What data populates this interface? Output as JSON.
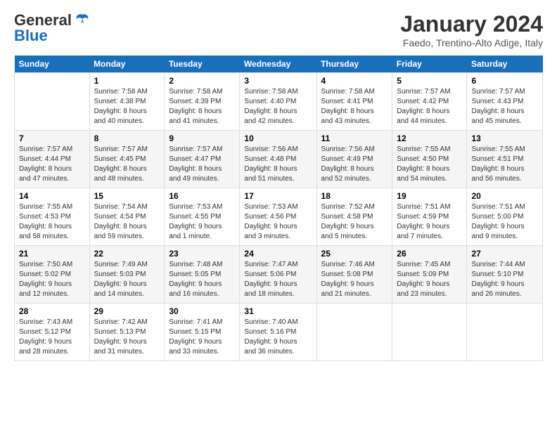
{
  "logo": {
    "line1": "General",
    "line2": "Blue"
  },
  "title": "January 2024",
  "subtitle": "Faedo, Trentino-Alto Adige, Italy",
  "days_header": [
    "Sunday",
    "Monday",
    "Tuesday",
    "Wednesday",
    "Thursday",
    "Friday",
    "Saturday"
  ],
  "weeks": [
    [
      {
        "num": "",
        "info": ""
      },
      {
        "num": "1",
        "info": "Sunrise: 7:58 AM\nSunset: 4:38 PM\nDaylight: 8 hours\nand 40 minutes."
      },
      {
        "num": "2",
        "info": "Sunrise: 7:58 AM\nSunset: 4:39 PM\nDaylight: 8 hours\nand 41 minutes."
      },
      {
        "num": "3",
        "info": "Sunrise: 7:58 AM\nSunset: 4:40 PM\nDaylight: 8 hours\nand 42 minutes."
      },
      {
        "num": "4",
        "info": "Sunrise: 7:58 AM\nSunset: 4:41 PM\nDaylight: 8 hours\nand 43 minutes."
      },
      {
        "num": "5",
        "info": "Sunrise: 7:57 AM\nSunset: 4:42 PM\nDaylight: 8 hours\nand 44 minutes."
      },
      {
        "num": "6",
        "info": "Sunrise: 7:57 AM\nSunset: 4:43 PM\nDaylight: 8 hours\nand 45 minutes."
      }
    ],
    [
      {
        "num": "7",
        "info": "Sunrise: 7:57 AM\nSunset: 4:44 PM\nDaylight: 8 hours\nand 47 minutes."
      },
      {
        "num": "8",
        "info": "Sunrise: 7:57 AM\nSunset: 4:45 PM\nDaylight: 8 hours\nand 48 minutes."
      },
      {
        "num": "9",
        "info": "Sunrise: 7:57 AM\nSunset: 4:47 PM\nDaylight: 8 hours\nand 49 minutes."
      },
      {
        "num": "10",
        "info": "Sunrise: 7:56 AM\nSunset: 4:48 PM\nDaylight: 8 hours\nand 51 minutes."
      },
      {
        "num": "11",
        "info": "Sunrise: 7:56 AM\nSunset: 4:49 PM\nDaylight: 8 hours\nand 52 minutes."
      },
      {
        "num": "12",
        "info": "Sunrise: 7:55 AM\nSunset: 4:50 PM\nDaylight: 8 hours\nand 54 minutes."
      },
      {
        "num": "13",
        "info": "Sunrise: 7:55 AM\nSunset: 4:51 PM\nDaylight: 8 hours\nand 56 minutes."
      }
    ],
    [
      {
        "num": "14",
        "info": "Sunrise: 7:55 AM\nSunset: 4:53 PM\nDaylight: 8 hours\nand 58 minutes."
      },
      {
        "num": "15",
        "info": "Sunrise: 7:54 AM\nSunset: 4:54 PM\nDaylight: 8 hours\nand 59 minutes."
      },
      {
        "num": "16",
        "info": "Sunrise: 7:53 AM\nSunset: 4:55 PM\nDaylight: 9 hours\nand 1 minute."
      },
      {
        "num": "17",
        "info": "Sunrise: 7:53 AM\nSunset: 4:56 PM\nDaylight: 9 hours\nand 3 minutes."
      },
      {
        "num": "18",
        "info": "Sunrise: 7:52 AM\nSunset: 4:58 PM\nDaylight: 9 hours\nand 5 minutes."
      },
      {
        "num": "19",
        "info": "Sunrise: 7:51 AM\nSunset: 4:59 PM\nDaylight: 9 hours\nand 7 minutes."
      },
      {
        "num": "20",
        "info": "Sunrise: 7:51 AM\nSunset: 5:00 PM\nDaylight: 9 hours\nand 9 minutes."
      }
    ],
    [
      {
        "num": "21",
        "info": "Sunrise: 7:50 AM\nSunset: 5:02 PM\nDaylight: 9 hours\nand 12 minutes."
      },
      {
        "num": "22",
        "info": "Sunrise: 7:49 AM\nSunset: 5:03 PM\nDaylight: 9 hours\nand 14 minutes."
      },
      {
        "num": "23",
        "info": "Sunrise: 7:48 AM\nSunset: 5:05 PM\nDaylight: 9 hours\nand 16 minutes."
      },
      {
        "num": "24",
        "info": "Sunrise: 7:47 AM\nSunset: 5:06 PM\nDaylight: 9 hours\nand 18 minutes."
      },
      {
        "num": "25",
        "info": "Sunrise: 7:46 AM\nSunset: 5:08 PM\nDaylight: 9 hours\nand 21 minutes."
      },
      {
        "num": "26",
        "info": "Sunrise: 7:45 AM\nSunset: 5:09 PM\nDaylight: 9 hours\nand 23 minutes."
      },
      {
        "num": "27",
        "info": "Sunrise: 7:44 AM\nSunset: 5:10 PM\nDaylight: 9 hours\nand 26 minutes."
      }
    ],
    [
      {
        "num": "28",
        "info": "Sunrise: 7:43 AM\nSunset: 5:12 PM\nDaylight: 9 hours\nand 28 minutes."
      },
      {
        "num": "29",
        "info": "Sunrise: 7:42 AM\nSunset: 5:13 PM\nDaylight: 9 hours\nand 31 minutes."
      },
      {
        "num": "30",
        "info": "Sunrise: 7:41 AM\nSunset: 5:15 PM\nDaylight: 9 hours\nand 33 minutes."
      },
      {
        "num": "31",
        "info": "Sunrise: 7:40 AM\nSunset: 5:16 PM\nDaylight: 9 hours\nand 36 minutes."
      },
      {
        "num": "",
        "info": ""
      },
      {
        "num": "",
        "info": ""
      },
      {
        "num": "",
        "info": ""
      }
    ]
  ]
}
